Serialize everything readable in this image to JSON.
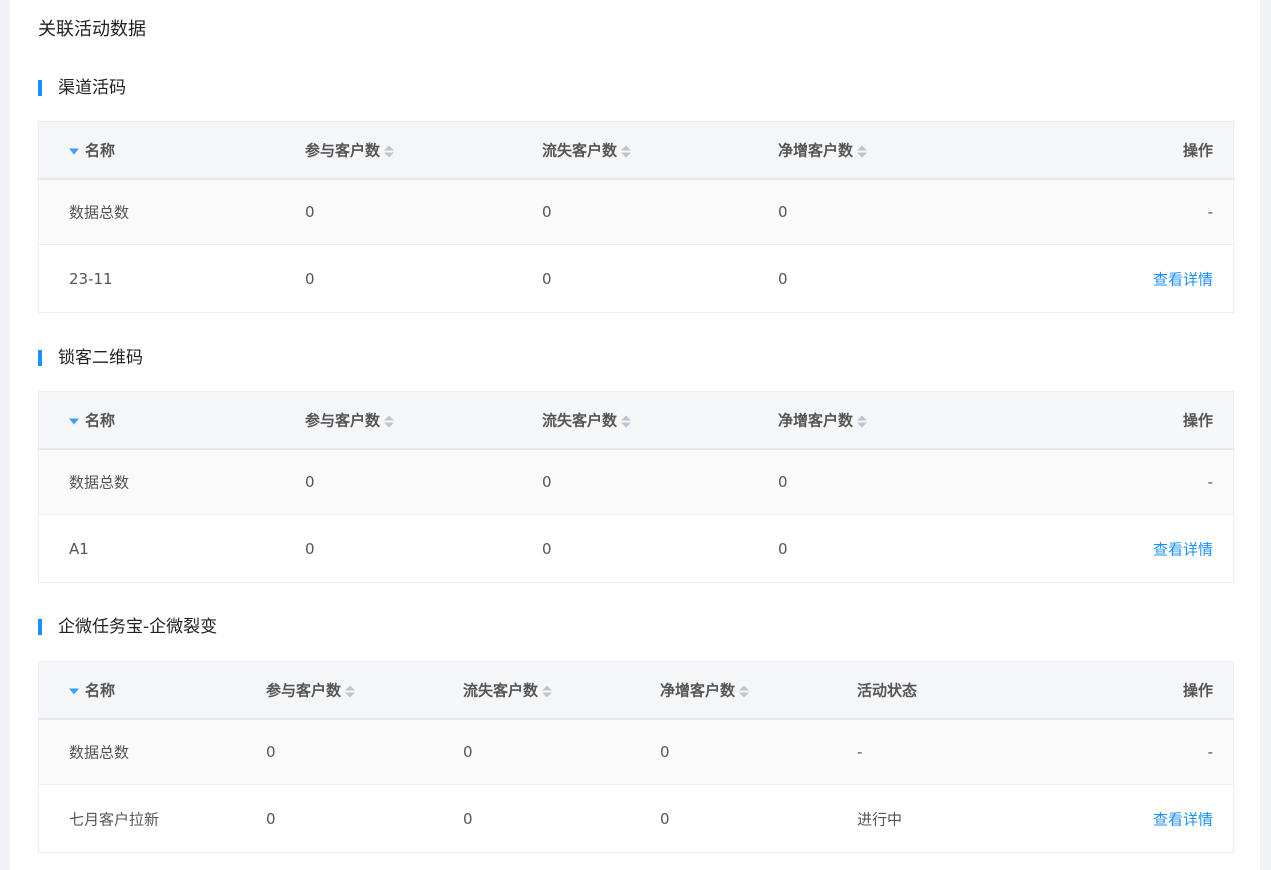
{
  "page_title": "关联活动数据",
  "sections": [
    {
      "title": "渠道活码",
      "headers": {
        "name": "名称",
        "participants": "参与客户数",
        "lost": "流失客户数",
        "net": "净增客户数",
        "action": "操作"
      },
      "total": {
        "name": "数据总数",
        "participants": "0",
        "lost": "0",
        "net": "0",
        "action": "-"
      },
      "item": {
        "name": "23-11",
        "participants": "0",
        "lost": "0",
        "net": "0",
        "action": "查看详情"
      }
    },
    {
      "title": "锁客二维码",
      "headers": {
        "name": "名称",
        "participants": "参与客户数",
        "lost": "流失客户数",
        "net": "净增客户数",
        "action": "操作"
      },
      "total": {
        "name": "数据总数",
        "participants": "0",
        "lost": "0",
        "net": "0",
        "action": "-"
      },
      "item": {
        "name": "A1",
        "participants": "0",
        "lost": "0",
        "net": "0",
        "action": "查看详情"
      }
    },
    {
      "title": "企微任务宝-企微裂变",
      "headers": {
        "name": "名称",
        "participants": "参与客户数",
        "lost": "流失客户数",
        "net": "净增客户数",
        "status": "活动状态",
        "action": "操作"
      },
      "total": {
        "name": "数据总数",
        "participants": "0",
        "lost": "0",
        "net": "0",
        "status": "-",
        "action": "-"
      },
      "item": {
        "name": "七月客户拉新",
        "participants": "0",
        "lost": "0",
        "net": "0",
        "status": "进行中",
        "action": "查看详情"
      }
    }
  ],
  "icons": {
    "sort_active": "caret-down-icon",
    "sort": "sort-icon"
  },
  "colors": {
    "accent": "#1890ff",
    "header_bg": "#f5f6f8"
  }
}
